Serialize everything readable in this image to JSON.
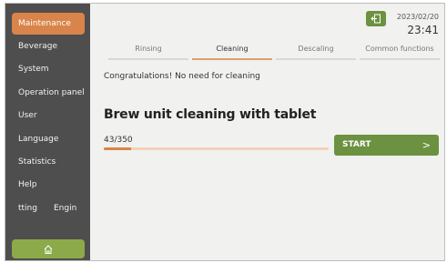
{
  "sidebar": {
    "items": [
      {
        "label": "Maintenance",
        "active": true
      },
      {
        "label": "Beverage"
      },
      {
        "label": "System"
      },
      {
        "label": "Operation panel"
      },
      {
        "label": "User"
      },
      {
        "label": "Language"
      },
      {
        "label": "Statistics"
      },
      {
        "label": "Help"
      }
    ],
    "truncated_item": {
      "left_text": "tting",
      "right_text": "Engin"
    },
    "home_icon": "home-icon"
  },
  "header": {
    "exit_icon": "exit-icon",
    "date": "2023/02/20",
    "time": "23:41"
  },
  "tabs": [
    {
      "label": "Rinsing",
      "active": false
    },
    {
      "label": "Cleaning",
      "active": true
    },
    {
      "label": "Descaling",
      "active": false
    },
    {
      "label": "Common functions",
      "active": false
    }
  ],
  "main": {
    "message": "Congratulations! No need for cleaning",
    "heading": "Brew unit cleaning with tablet",
    "counter": "43/350",
    "progress_fraction": 0.123,
    "start_label": "START",
    "start_chevron": ">"
  },
  "colors": {
    "accent": "#d9844a",
    "green": "#6c9140",
    "sidebar_bg": "#4e4e4e"
  }
}
